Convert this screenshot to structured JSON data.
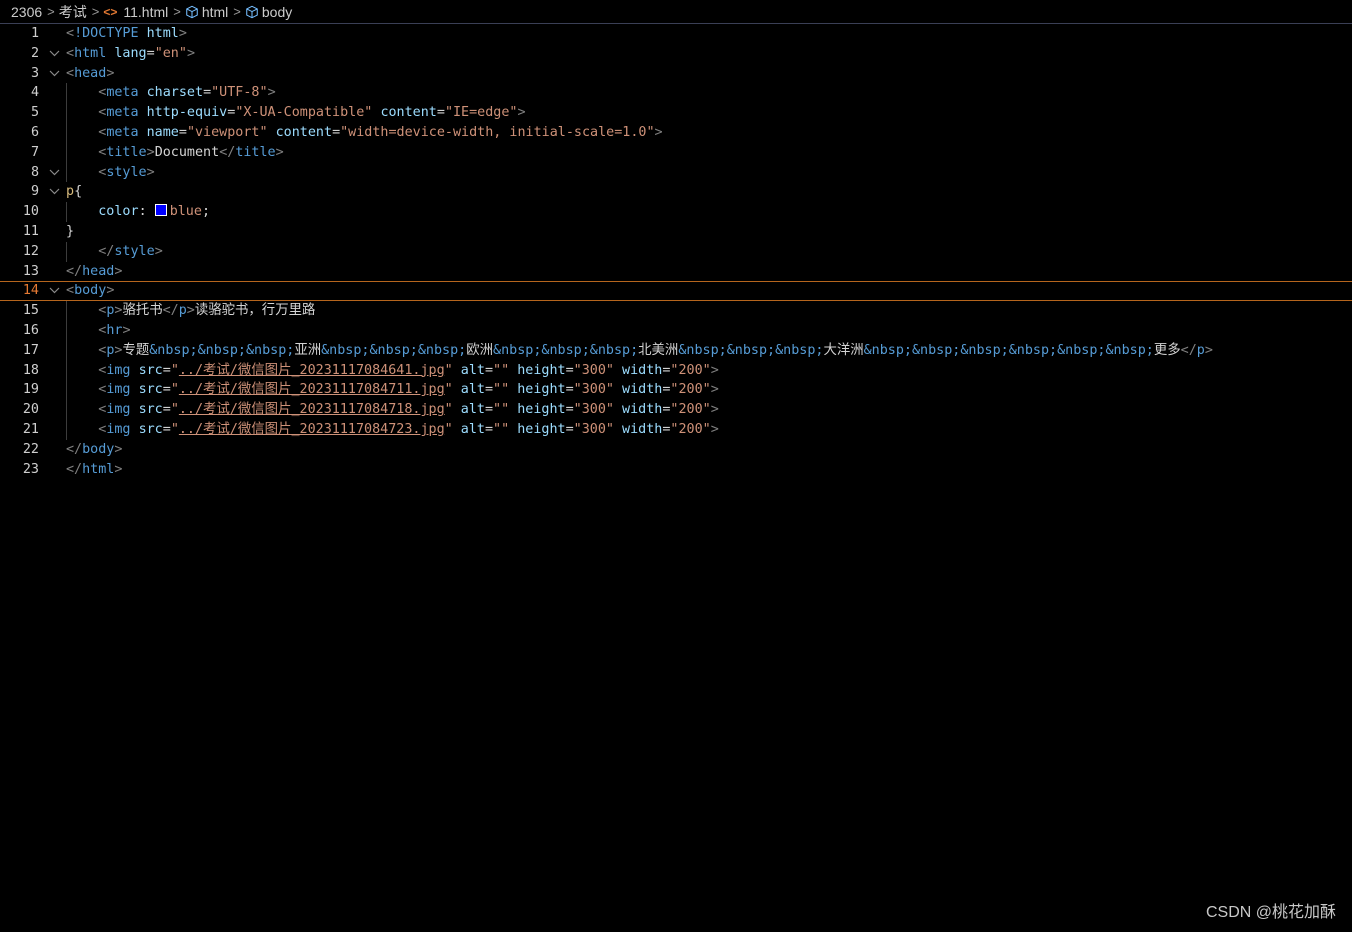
{
  "breadcrumb": {
    "folder": "2306",
    "subfolder": "考试",
    "file": "11.html",
    "element1": "html",
    "element2": "body",
    "file_icon": "<>",
    "separator": ">"
  },
  "editor": {
    "current_line": 14,
    "lines": [
      {
        "n": "1",
        "tokens": [
          [
            "b",
            "<"
          ],
          [
            "t",
            "!DOCTYPE"
          ],
          [
            "x",
            " "
          ],
          [
            "a",
            "html"
          ],
          [
            "b",
            ">"
          ]
        ]
      },
      {
        "n": "2",
        "fold": true,
        "tokens": [
          [
            "b",
            "<"
          ],
          [
            "t",
            "html"
          ],
          [
            "x",
            " "
          ],
          [
            "a",
            "lang"
          ],
          [
            "x",
            "="
          ],
          [
            "s",
            "\"en\""
          ],
          [
            "b",
            ">"
          ]
        ]
      },
      {
        "n": "3",
        "fold": true,
        "tokens": [
          [
            "b",
            "<"
          ],
          [
            "t",
            "head"
          ],
          [
            "b",
            ">"
          ]
        ]
      },
      {
        "n": "4",
        "tokens": [
          [
            "x",
            "    "
          ],
          [
            "b",
            "<"
          ],
          [
            "t",
            "meta"
          ],
          [
            "x",
            " "
          ],
          [
            "a",
            "charset"
          ],
          [
            "x",
            "="
          ],
          [
            "s",
            "\"UTF-8\""
          ],
          [
            "b",
            ">"
          ]
        ]
      },
      {
        "n": "5",
        "tokens": [
          [
            "x",
            "    "
          ],
          [
            "b",
            "<"
          ],
          [
            "t",
            "meta"
          ],
          [
            "x",
            " "
          ],
          [
            "a",
            "http-equiv"
          ],
          [
            "x",
            "="
          ],
          [
            "s",
            "\"X-UA-Compatible\""
          ],
          [
            "x",
            " "
          ],
          [
            "a",
            "content"
          ],
          [
            "x",
            "="
          ],
          [
            "s",
            "\"IE=edge\""
          ],
          [
            "b",
            ">"
          ]
        ]
      },
      {
        "n": "6",
        "tokens": [
          [
            "x",
            "    "
          ],
          [
            "b",
            "<"
          ],
          [
            "t",
            "meta"
          ],
          [
            "x",
            " "
          ],
          [
            "a",
            "name"
          ],
          [
            "x",
            "="
          ],
          [
            "s",
            "\"viewport\""
          ],
          [
            "x",
            " "
          ],
          [
            "a",
            "content"
          ],
          [
            "x",
            "="
          ],
          [
            "s",
            "\"width=device-width, initial-scale=1.0\""
          ],
          [
            "b",
            ">"
          ]
        ]
      },
      {
        "n": "7",
        "tokens": [
          [
            "x",
            "    "
          ],
          [
            "b",
            "<"
          ],
          [
            "t",
            "title"
          ],
          [
            "b",
            ">"
          ],
          [
            "x",
            "Document"
          ],
          [
            "b",
            "</"
          ],
          [
            "t",
            "title"
          ],
          [
            "b",
            ">"
          ]
        ]
      },
      {
        "n": "8",
        "fold": true,
        "tokens": [
          [
            "x",
            "    "
          ],
          [
            "b",
            "<"
          ],
          [
            "t",
            "style"
          ],
          [
            "b",
            ">"
          ]
        ]
      },
      {
        "n": "9",
        "fold": true,
        "tokens": [
          [
            "sel",
            "p"
          ],
          [
            "x",
            "{"
          ]
        ]
      },
      {
        "n": "10",
        "tokens": [
          [
            "x",
            "    "
          ],
          [
            "a",
            "color"
          ],
          [
            "x",
            ": "
          ],
          [
            "swatch",
            "#0000ff"
          ],
          [
            "s",
            "blue"
          ],
          [
            "x",
            ";"
          ]
        ]
      },
      {
        "n": "11",
        "tokens": [
          [
            "x",
            "}"
          ]
        ]
      },
      {
        "n": "12",
        "tokens": [
          [
            "x",
            "    "
          ],
          [
            "b",
            "</"
          ],
          [
            "t",
            "style"
          ],
          [
            "b",
            ">"
          ]
        ]
      },
      {
        "n": "13",
        "tokens": [
          [
            "b",
            "</"
          ],
          [
            "t",
            "head"
          ],
          [
            "b",
            ">"
          ]
        ]
      },
      {
        "n": "14",
        "fold": true,
        "tokens": [
          [
            "b",
            "<"
          ],
          [
            "t",
            "body"
          ],
          [
            "b",
            ">"
          ]
        ]
      },
      {
        "n": "15",
        "tokens": [
          [
            "x",
            "    "
          ],
          [
            "b",
            "<"
          ],
          [
            "t",
            "p"
          ],
          [
            "b",
            ">"
          ],
          [
            "x",
            "骆托书"
          ],
          [
            "b",
            "</"
          ],
          [
            "t",
            "p"
          ],
          [
            "b",
            ">"
          ],
          [
            "x",
            "读骆驼书，行万里路"
          ]
        ]
      },
      {
        "n": "16",
        "tokens": [
          [
            "x",
            "    "
          ],
          [
            "b",
            "<"
          ],
          [
            "t",
            "hr"
          ],
          [
            "b",
            ">"
          ]
        ]
      },
      {
        "n": "17",
        "tokens": [
          [
            "x",
            "    "
          ],
          [
            "b",
            "<"
          ],
          [
            "t",
            "p"
          ],
          [
            "b",
            ">"
          ],
          [
            "x",
            "专题"
          ],
          [
            "e",
            "&nbsp;&nbsp;&nbsp;"
          ],
          [
            "x",
            "亚洲"
          ],
          [
            "e",
            "&nbsp;&nbsp;&nbsp;"
          ],
          [
            "x",
            "欧洲"
          ],
          [
            "e",
            "&nbsp;&nbsp;&nbsp;"
          ],
          [
            "x",
            "北美洲"
          ],
          [
            "e",
            "&nbsp;&nbsp;&nbsp;"
          ],
          [
            "x",
            "大洋洲"
          ],
          [
            "e",
            "&nbsp;&nbsp;&nbsp;&nbsp;&nbsp;&nbsp;"
          ],
          [
            "x",
            "更多"
          ],
          [
            "b",
            "</"
          ],
          [
            "t",
            "p"
          ],
          [
            "b",
            ">"
          ]
        ]
      },
      {
        "n": "18",
        "tokens": [
          [
            "x",
            "    "
          ],
          [
            "b",
            "<"
          ],
          [
            "t",
            "img"
          ],
          [
            "x",
            " "
          ],
          [
            "a",
            "src"
          ],
          [
            "x",
            "="
          ],
          [
            "s",
            "\""
          ],
          [
            "u",
            "../考试/微信图片_20231117084641.jpg"
          ],
          [
            "s",
            "\""
          ],
          [
            "x",
            " "
          ],
          [
            "a",
            "alt"
          ],
          [
            "x",
            "="
          ],
          [
            "s",
            "\"\""
          ],
          [
            "x",
            " "
          ],
          [
            "a",
            "height"
          ],
          [
            "x",
            "="
          ],
          [
            "s",
            "\"300\""
          ],
          [
            "x",
            " "
          ],
          [
            "a",
            "width"
          ],
          [
            "x",
            "="
          ],
          [
            "s",
            "\"200\""
          ],
          [
            "b",
            ">"
          ]
        ]
      },
      {
        "n": "19",
        "tokens": [
          [
            "x",
            "    "
          ],
          [
            "b",
            "<"
          ],
          [
            "t",
            "img"
          ],
          [
            "x",
            " "
          ],
          [
            "a",
            "src"
          ],
          [
            "x",
            "="
          ],
          [
            "s",
            "\""
          ],
          [
            "u",
            "../考试/微信图片_20231117084711.jpg"
          ],
          [
            "s",
            "\""
          ],
          [
            "x",
            " "
          ],
          [
            "a",
            "alt"
          ],
          [
            "x",
            "="
          ],
          [
            "s",
            "\"\""
          ],
          [
            "x",
            " "
          ],
          [
            "a",
            "height"
          ],
          [
            "x",
            "="
          ],
          [
            "s",
            "\"300\""
          ],
          [
            "x",
            " "
          ],
          [
            "a",
            "width"
          ],
          [
            "x",
            "="
          ],
          [
            "s",
            "\"200\""
          ],
          [
            "b",
            ">"
          ]
        ]
      },
      {
        "n": "20",
        "tokens": [
          [
            "x",
            "    "
          ],
          [
            "b",
            "<"
          ],
          [
            "t",
            "img"
          ],
          [
            "x",
            " "
          ],
          [
            "a",
            "src"
          ],
          [
            "x",
            "="
          ],
          [
            "s",
            "\""
          ],
          [
            "u",
            "../考试/微信图片_20231117084718.jpg"
          ],
          [
            "s",
            "\""
          ],
          [
            "x",
            " "
          ],
          [
            "a",
            "alt"
          ],
          [
            "x",
            "="
          ],
          [
            "s",
            "\"\""
          ],
          [
            "x",
            " "
          ],
          [
            "a",
            "height"
          ],
          [
            "x",
            "="
          ],
          [
            "s",
            "\"300\""
          ],
          [
            "x",
            " "
          ],
          [
            "a",
            "width"
          ],
          [
            "x",
            "="
          ],
          [
            "s",
            "\"200\""
          ],
          [
            "b",
            ">"
          ]
        ]
      },
      {
        "n": "21",
        "tokens": [
          [
            "x",
            "    "
          ],
          [
            "b",
            "<"
          ],
          [
            "t",
            "img"
          ],
          [
            "x",
            " "
          ],
          [
            "a",
            "src"
          ],
          [
            "x",
            "="
          ],
          [
            "s",
            "\""
          ],
          [
            "u",
            "../考试/微信图片_20231117084723.jpg"
          ],
          [
            "s",
            "\""
          ],
          [
            "x",
            " "
          ],
          [
            "a",
            "alt"
          ],
          [
            "x",
            "="
          ],
          [
            "s",
            "\"\""
          ],
          [
            "x",
            " "
          ],
          [
            "a",
            "height"
          ],
          [
            "x",
            "="
          ],
          [
            "s",
            "\"300\""
          ],
          [
            "x",
            " "
          ],
          [
            "a",
            "width"
          ],
          [
            "x",
            "="
          ],
          [
            "s",
            "\"200\""
          ],
          [
            "b",
            ">"
          ]
        ]
      },
      {
        "n": "22",
        "tokens": [
          [
            "b",
            "</"
          ],
          [
            "t",
            "body"
          ],
          [
            "b",
            ">"
          ]
        ]
      },
      {
        "n": "23",
        "tokens": [
          [
            "b",
            "</"
          ],
          [
            "t",
            "html"
          ],
          [
            "b",
            ">"
          ]
        ]
      }
    ]
  },
  "watermark": "CSDN @桃花加酥",
  "colors": {
    "background": "#000000",
    "tag": "#569cd6",
    "attribute": "#9cdcfe",
    "string": "#ce9178",
    "current_line_border": "#b5651d",
    "active_line_number": "#e37933"
  }
}
